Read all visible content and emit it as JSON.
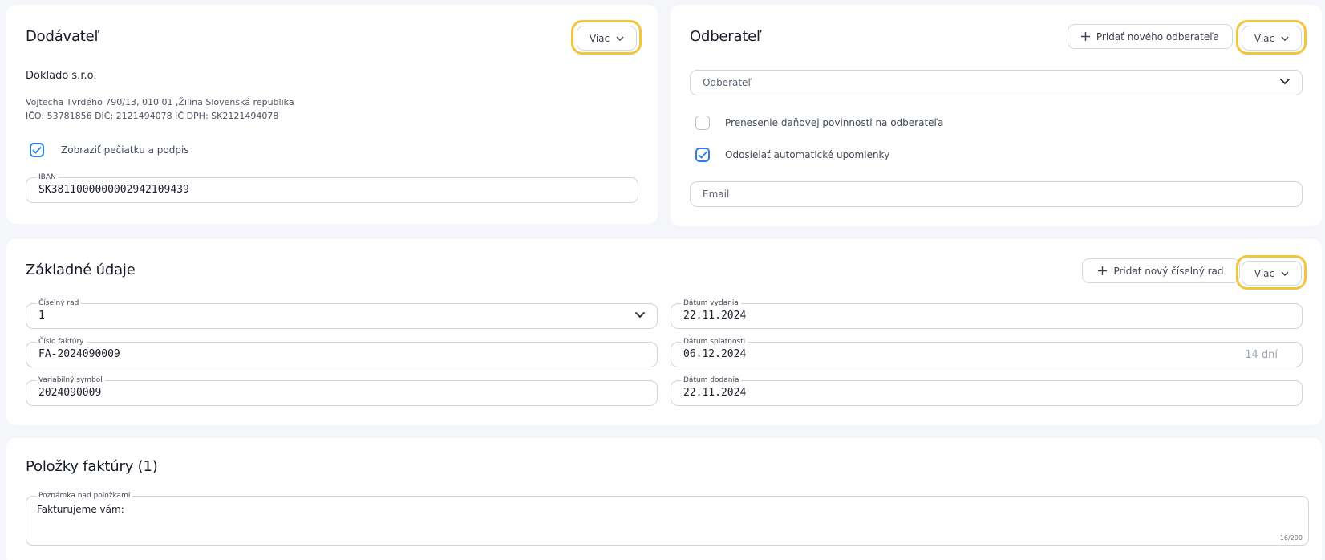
{
  "supplier": {
    "title": "Dodávateľ",
    "more_label": "Viac",
    "company_name": "Doklado s.r.o.",
    "address_line": "Vojtecha Tvrdého 790/13, 010 01 ,Žilina Slovenská republika",
    "ids_line": "IČO: 53781856 DIČ: 2121494078 IČ DPH: SK2121494078",
    "stamp_checkbox": {
      "label": "Zobraziť pečiatku a podpis",
      "checked": true
    },
    "iban": {
      "label": "IBAN",
      "value": "SK3811000000002942109439"
    }
  },
  "customer": {
    "title": "Odberateľ",
    "add_label": "Pridať nového odberateľa",
    "more_label": "Viac",
    "select_placeholder": "Odberateľ",
    "reverse_charge": {
      "label": "Prenesenie daňovej povinnosti na odberateľa",
      "checked": false
    },
    "auto_reminders": {
      "label": "Odosielať automatické upomienky",
      "checked": true
    },
    "email_placeholder": "Email"
  },
  "basic": {
    "title": "Základné údaje",
    "add_series_label": "Pridať nový číselný rad",
    "more_label": "Viac",
    "number_series": {
      "label": "Číselný rad",
      "value": "1"
    },
    "invoice_number": {
      "label": "Číslo faktúry",
      "value": "FA-2024090009"
    },
    "variable_symbol": {
      "label": "Variabilný symbol",
      "value": "2024090009"
    },
    "issue_date": {
      "label": "Dátum vydania",
      "value": "22.11.2024"
    },
    "due_date": {
      "label": "Dátum splatnosti",
      "value": "06.12.2024",
      "suffix": "14 dní"
    },
    "delivery_date": {
      "label": "Dátum dodania",
      "value": "22.11.2024"
    }
  },
  "items": {
    "title": "Položky faktúry (1)",
    "note": {
      "label": "Poznámka nad položkami",
      "value": "Fakturujeme vám:",
      "counter": "16/200"
    }
  },
  "colors": {
    "highlight": "#f3c53c",
    "checkbox": "#2f7de0",
    "background": "#f4f6f9"
  }
}
